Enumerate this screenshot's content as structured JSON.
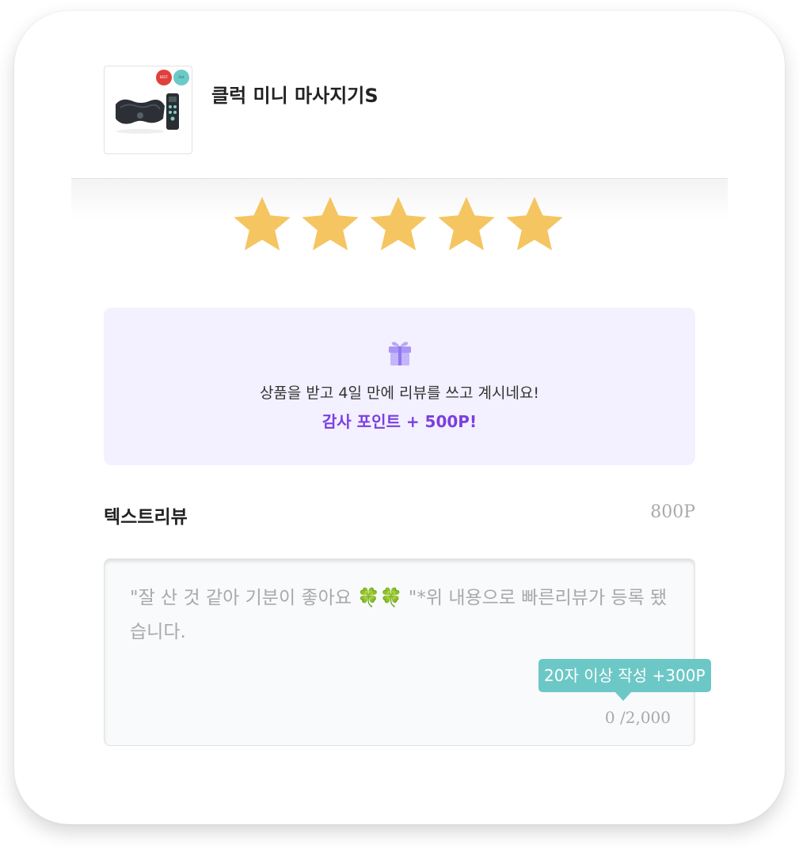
{
  "product": {
    "name": "클럭 미니 마사지기S",
    "image_alt": "massager-product-image",
    "badges": [
      "BEST",
      "Hot"
    ]
  },
  "rating": {
    "value": 5,
    "max": 5,
    "color": "#f5c561"
  },
  "reward_banner": {
    "icon": "gift-icon",
    "message": "상품을 받고 4일 만에 리뷰를 쓰고 계시네요!",
    "points": "감사 포인트 + 500P!",
    "accent_color": "#7a3fe0",
    "background_color": "#f3f0ff"
  },
  "text_review": {
    "title": "텍스트리뷰",
    "points": "800P",
    "placeholder_parts": [
      "\"잘 산 것 같아 기분이 좋아요 ",
      "🍀🍀",
      " \"*위 내용으로 빠른리뷰가 등록 됐습니다."
    ],
    "tooltip": "20자 이상 작성 +300P",
    "tooltip_color": "#6cc8c6",
    "char_count": "0 /2,000"
  }
}
